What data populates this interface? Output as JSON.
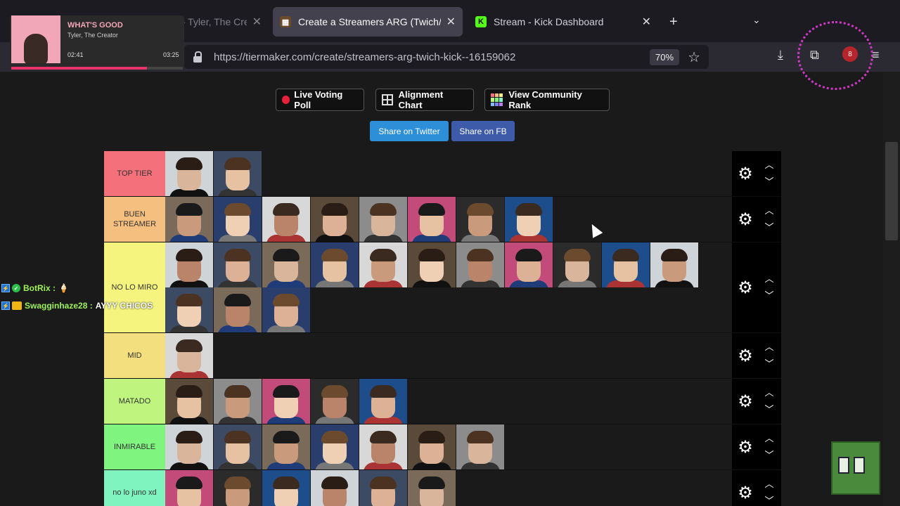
{
  "browser": {
    "tabs": [
      {
        "title": "WHAT'S GOOD - Tyler, The Creator",
        "favicon": "music-icon"
      },
      {
        "title": "Create a Streamers ARG (Twich/Kick) Tier List",
        "favicon": "tiermaker-icon"
      },
      {
        "title": "Stream - Kick Dashboard",
        "favicon": "kick-icon",
        "favicon_text": "K"
      }
    ],
    "url": "https://tiermaker.com/create/streamers-arg-twich-kick--16159062",
    "zoom": "70%",
    "badge_count": "8"
  },
  "now_playing": {
    "title": "WHAT'S GOOD",
    "artist": "Tyler, The Creator",
    "current": "02:41",
    "total": "03:25",
    "progress": 0.79
  },
  "toolbar": {
    "live_poll": "Live Voting Poll",
    "alignment": "Alignment Chart",
    "community": "View Community Rank",
    "share_twitter": "Share on Twitter",
    "share_fb": "Share on FB"
  },
  "tiers": [
    {
      "label": "TOP TIER",
      "color": "#f4717b",
      "count": 2
    },
    {
      "label": "BUEN STREAMER",
      "color": "#f4bf7f",
      "count": 8
    },
    {
      "label": "NO LO MIRO",
      "color": "#f4f47f",
      "count": 14
    },
    {
      "label": "MID",
      "color": "#f4df7f",
      "count": 1
    },
    {
      "label": "MATADO",
      "color": "#bff47f",
      "count": 5
    },
    {
      "label": "INMIRABLE",
      "color": "#7ff47f",
      "count": 7
    },
    {
      "label": "no lo juno xd",
      "color": "#7ff4bf",
      "count": 6
    }
  ],
  "chat": [
    {
      "user": "BotRix :",
      "message": "🍦"
    },
    {
      "user": "Swagginhaze28 :",
      "message": "AYYY CHICOS"
    }
  ]
}
